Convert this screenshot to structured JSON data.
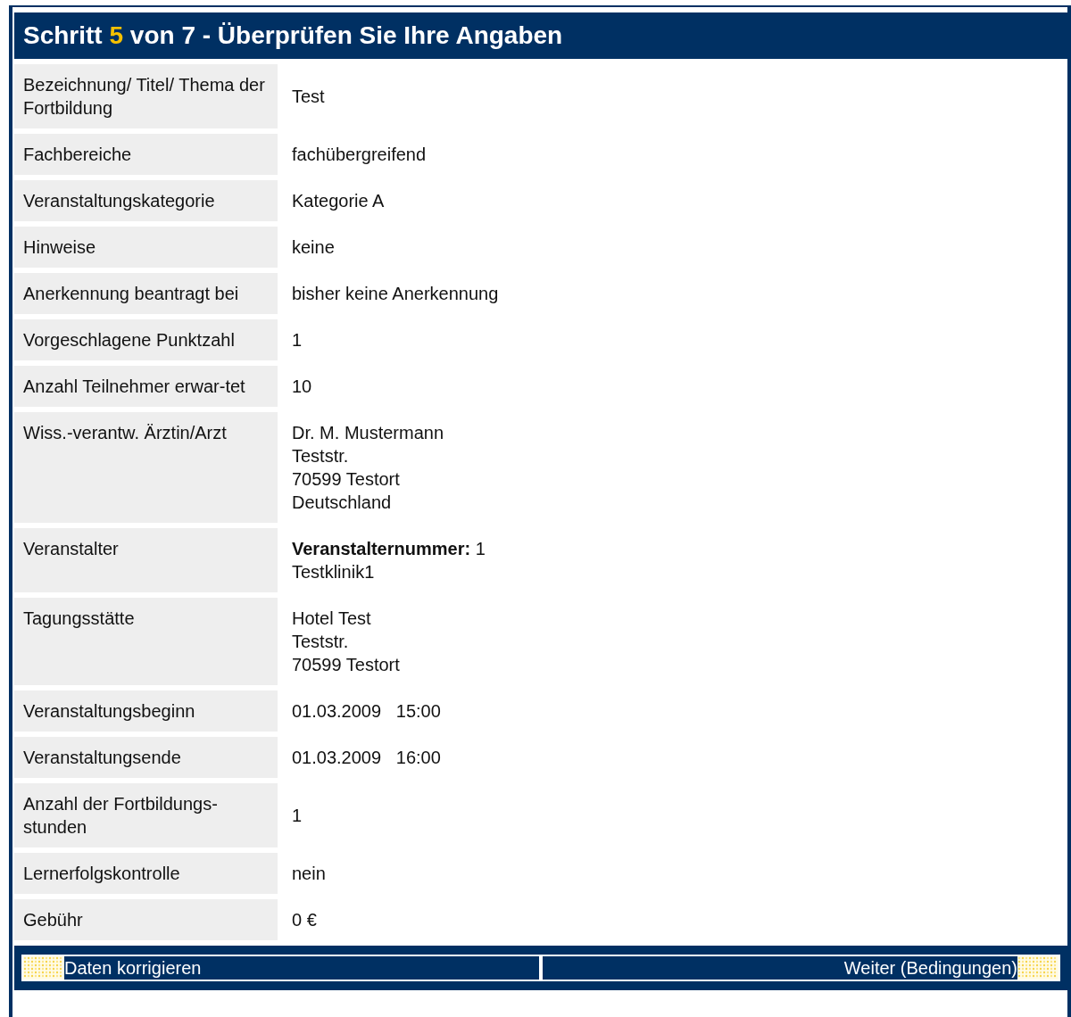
{
  "heading": {
    "prefix": "Schritt",
    "step": "5",
    "suffix": "von 7 - Überprüfen Sie Ihre Angaben"
  },
  "rows": [
    {
      "label": "Bezeichnung/ Titel/ Thema der Fortbildung",
      "value": [
        "Test"
      ]
    },
    {
      "label": "Fachbereiche",
      "value": [
        "fachübergreifend"
      ]
    },
    {
      "label": "Veranstaltungskategorie",
      "value": [
        "Kategorie A"
      ]
    },
    {
      "label": "Hinweise",
      "value": [
        "keine"
      ]
    },
    {
      "label": "Anerkennung beantragt bei",
      "value": [
        "bisher keine Anerkennung"
      ]
    },
    {
      "label": "Vorgeschlagene Punktzahl",
      "value": [
        "1"
      ]
    },
    {
      "label": "Anzahl Teilnehmer erwar-tet",
      "value": [
        "10"
      ]
    },
    {
      "label": "Wiss.-verantw. Ärztin/Arzt",
      "value": [
        "Dr. M. Mustermann",
        "Teststr.",
        "70599 Testort",
        "Deutschland"
      ]
    },
    {
      "label": "Veranstalter",
      "value": [
        "**Veranstalternummer:** 1",
        "Testklinik1"
      ]
    },
    {
      "label": "Tagungsstätte",
      "value": [
        "Hotel Test",
        "Teststr.",
        "70599 Testort"
      ]
    },
    {
      "label": "Veranstaltungsbeginn",
      "value": [
        "01.03.2009   15:00"
      ]
    },
    {
      "label": "Veranstaltungsende",
      "value": [
        "01.03.2009   16:00"
      ]
    },
    {
      "label": "Anzahl der Fortbildungs-stunden",
      "value": [
        "1"
      ]
    },
    {
      "label": "Lernerfolgskontrolle",
      "value": [
        "nein"
      ]
    },
    {
      "label": "Gebühr",
      "value": [
        "0 €"
      ]
    }
  ],
  "buttons": [
    {
      "label": "Daten korrigieren",
      "kind": "back"
    },
    {
      "label": "Weiter (Bedingungen)",
      "kind": "next"
    }
  ]
}
